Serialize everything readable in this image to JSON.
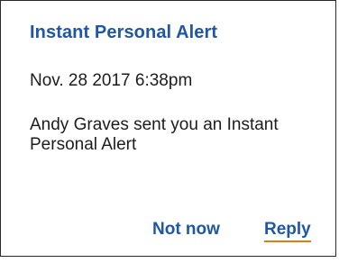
{
  "alert": {
    "title": "Instant Personal Alert",
    "timestamp": "Nov. 28 2017 6:38pm",
    "message": "Andy Graves sent you an Instant Personal Alert"
  },
  "actions": {
    "not_now_label": "Not now",
    "reply_label": "Reply"
  },
  "colors": {
    "accent": "#1f57a6",
    "focus_underline": "#e07a12",
    "text": "#1c1c1c"
  }
}
